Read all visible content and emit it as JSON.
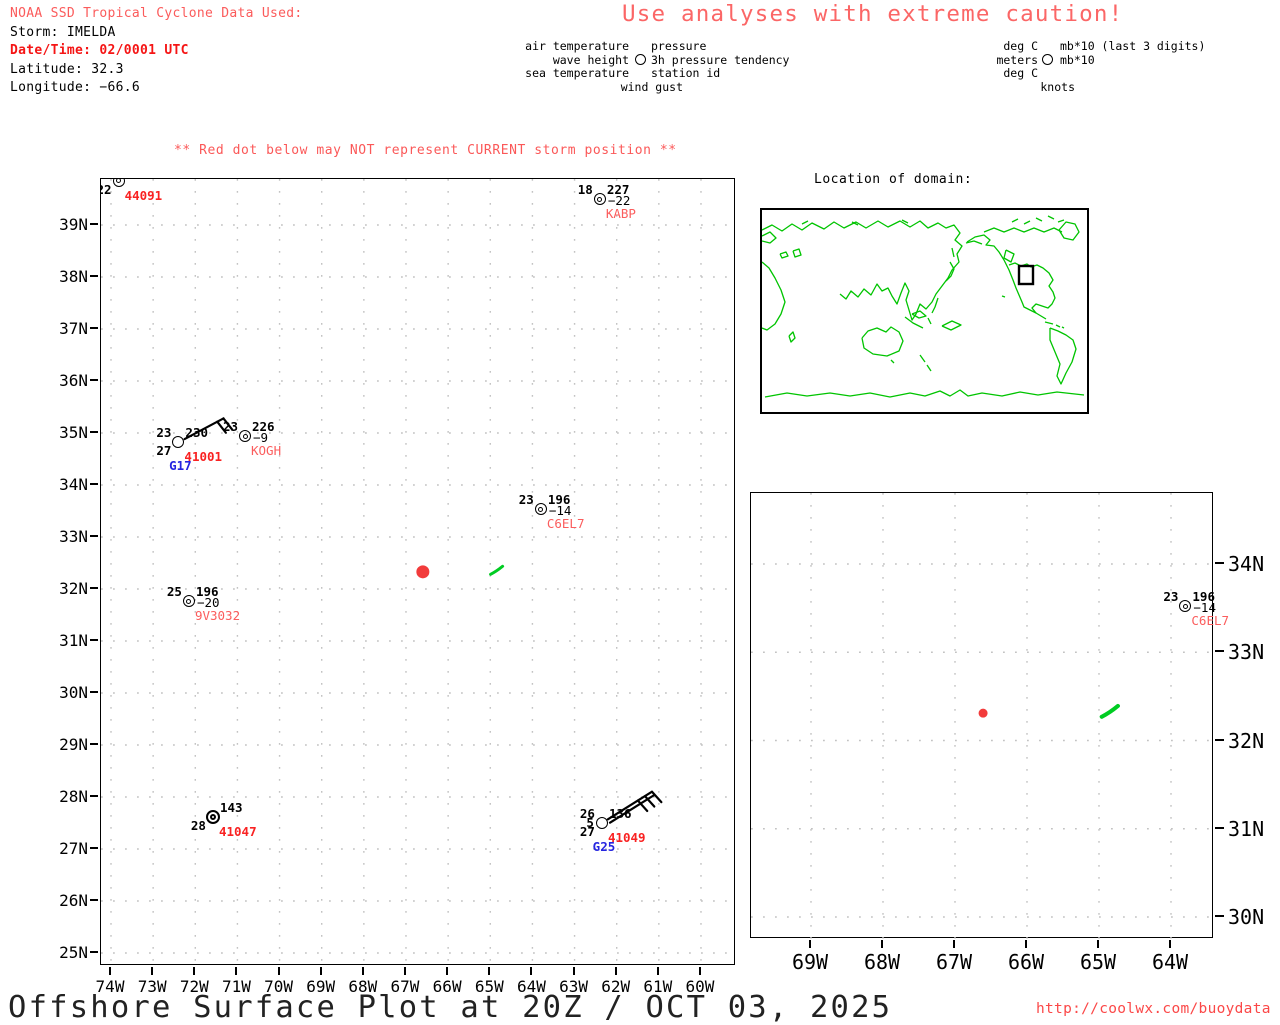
{
  "colors": {
    "soft_red": "#fb5b5b",
    "alert_red": "#f51515",
    "buoy_id_red": "#f92222",
    "ship_id_red": "#fb5d5d",
    "gust_blue": "#2525e0",
    "map_green": "#00c400",
    "storm_dot_red": "#f23b3b"
  },
  "header": {
    "source_line": "NOAA SSD Tropical Cyclone Data Used:",
    "storm_line": "Storm: IMELDA",
    "datetime_line": "Date/Time: 02/0001 UTC",
    "latitude_line": "Latitude: 32.3",
    "longitude_line": "Longitude: −66.6"
  },
  "caution_title": "Use analyses with extreme caution!",
  "plot_legend": {
    "air_temperature": "air temperature",
    "pressure": "pressure",
    "wave_height": "wave height",
    "pressure_tendency": "3h pressure tendency",
    "sea_temperature": "sea temperature",
    "station_id": "station id",
    "wind_gust": "wind gust"
  },
  "unit_legend": {
    "air_units": "deg C",
    "pressure_units": "mb*10 (last 3 digits)",
    "wave_units": "meters",
    "tendency_units": "mb*10",
    "sea_units": "deg C",
    "gust_units": "knots"
  },
  "warning_line": "** Red dot below may NOT represent CURRENT storm position **",
  "inset": {
    "title": "Location of domain:"
  },
  "main_map": {
    "x_tick_labels": [
      "74W",
      "73W",
      "72W",
      "71W",
      "70W",
      "69W",
      "68W",
      "67W",
      "66W",
      "65W",
      "64W",
      "63W",
      "62W",
      "61W",
      "60W"
    ],
    "y_tick_labels": [
      "39N",
      "38N",
      "37N",
      "36N",
      "35N",
      "34N",
      "33N",
      "32N",
      "31N",
      "30N",
      "29N",
      "28N",
      "27N",
      "26N",
      "25N"
    ],
    "storm_dot": {
      "lat": 32.33,
      "lon": 66.6
    },
    "green_mark": {
      "lat": 32.36,
      "lon": 64.85
    },
    "stations": [
      {
        "id": "44091",
        "id_style": "buoy",
        "circle": "double",
        "lat": 39.85,
        "lon": 73.82,
        "sea": "22"
      },
      {
        "id": "KABP",
        "id_style": "ship",
        "circle": "double",
        "lat": 39.5,
        "lon": 62.4,
        "air": "18",
        "pressure": "227",
        "tendency": "−22"
      },
      {
        "id": "41001",
        "id_style": "buoy",
        "circle": "open",
        "lat": 34.82,
        "lon": 72.4,
        "air": "23",
        "sea": "27",
        "pressure": "230",
        "gust": "G17",
        "barb": {
          "angle": 28,
          "length": 44,
          "feathers": 2,
          "shafts": 1
        }
      },
      {
        "id": "KOGH",
        "id_style": "ship",
        "circle": "double",
        "lat": 34.94,
        "lon": 70.82,
        "air": "23",
        "pressure": "226",
        "tendency": "−9"
      },
      {
        "id": "C6EL7",
        "id_style": "ship",
        "circle": "double",
        "lat": 33.53,
        "lon": 63.8,
        "air": "23",
        "pressure": "196",
        "tendency": "−14"
      },
      {
        "id": "9V3032",
        "id_style": "ship",
        "circle": "double",
        "lat": 31.76,
        "lon": 72.15,
        "air": "25",
        "pressure": "196",
        "tendency": "−20"
      },
      {
        "id": "41047",
        "id_style": "buoy",
        "circle": "double-bold",
        "lat": 27.62,
        "lon": 71.58,
        "sea": "28",
        "pressure": "143"
      },
      {
        "id": "41049",
        "id_style": "buoy",
        "circle": "open",
        "lat": 27.5,
        "lon": 62.35,
        "air": "26",
        "wave": "5",
        "sea": "27",
        "pressure": "136",
        "gust": "G25",
        "barb": {
          "angle": 32,
          "length": 52,
          "feathers": 3,
          "shafts": 2
        }
      }
    ]
  },
  "zoom_map": {
    "x_tick_labels": [
      "69W",
      "68W",
      "67W",
      "66W",
      "65W",
      "64W"
    ],
    "y_tick_labels": [
      "34N",
      "33N",
      "32N",
      "31N",
      "30N"
    ],
    "storm_dot": {
      "lat": 32.31,
      "lon": 66.61
    },
    "green_mark": {
      "lat": 32.33,
      "lon": 64.85
    },
    "stations": [
      {
        "id": "C6EL7",
        "id_style": "ship",
        "circle": "double",
        "lat": 33.52,
        "lon": 63.8,
        "air": "23",
        "pressure": "196",
        "tendency": "−14"
      }
    ]
  },
  "footer": {
    "title": "Offshore Surface Plot at 20Z / OCT 03, 2025",
    "url": "http://coolwx.com/buoydata"
  }
}
